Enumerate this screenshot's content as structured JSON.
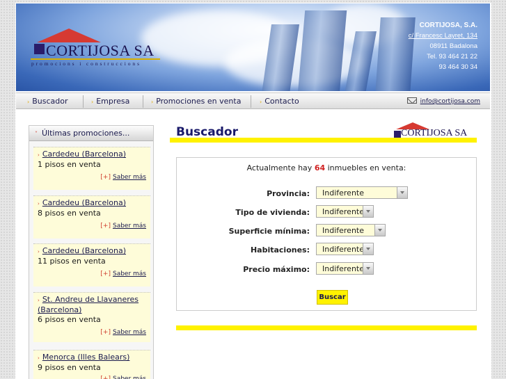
{
  "brand": {
    "name": "CORTIJOSA SA",
    "tagline": "promocions i construccions"
  },
  "company": {
    "name": "CORTIJOSA, S.A.",
    "address": "c/ Francesc Layret, 134",
    "city": "08911 Badalona",
    "phone": "Tel. 93 464 21 22",
    "fax": "93 464 30 34"
  },
  "nav": {
    "items": [
      {
        "label": "Buscador"
      },
      {
        "label": "Empresa"
      },
      {
        "label": "Promociones en venta"
      },
      {
        "label": "Contacto"
      }
    ],
    "email": "info@cortijosa.com",
    "arrow": "›"
  },
  "sidebar": {
    "title": "Últimas promociones...",
    "more_bracket": "[+]",
    "more_label": "Saber más",
    "items": [
      {
        "location": "Cardedeu (Barcelona)",
        "count": "1 pisos en venta"
      },
      {
        "location": "Cardedeu (Barcelona)",
        "count": "8 pisos en venta"
      },
      {
        "location": "Cardedeu (Barcelona)",
        "count": "11 pisos en venta"
      },
      {
        "location": "St. Andreu de Llavaneres (Barcelona)",
        "count": "6 pisos en venta"
      },
      {
        "location": "Menorca (Illes Balears)",
        "count": "9 pisos en venta"
      }
    ]
  },
  "main": {
    "title": "Buscador",
    "intro_prefix": "Actualmente hay",
    "intro_count": "64",
    "intro_suffix": "inmuebles en venta:",
    "fields": [
      {
        "label": "Provincia:",
        "value": "Indiferente"
      },
      {
        "label": "Tipo de vivienda:",
        "value": "Indiferente"
      },
      {
        "label": "Superficie mínima:",
        "value": "Indiferente"
      },
      {
        "label": "Habitaciones:",
        "value": "Indiferente"
      },
      {
        "label": "Precio máximo:",
        "value": "Indiferente"
      }
    ],
    "submit": "Buscar"
  },
  "colors": {
    "accent_yellow": "#fff200",
    "brand_navy": "#1c1450",
    "roof_red": "#d63a32",
    "promo_bg": "#fefcd9"
  }
}
